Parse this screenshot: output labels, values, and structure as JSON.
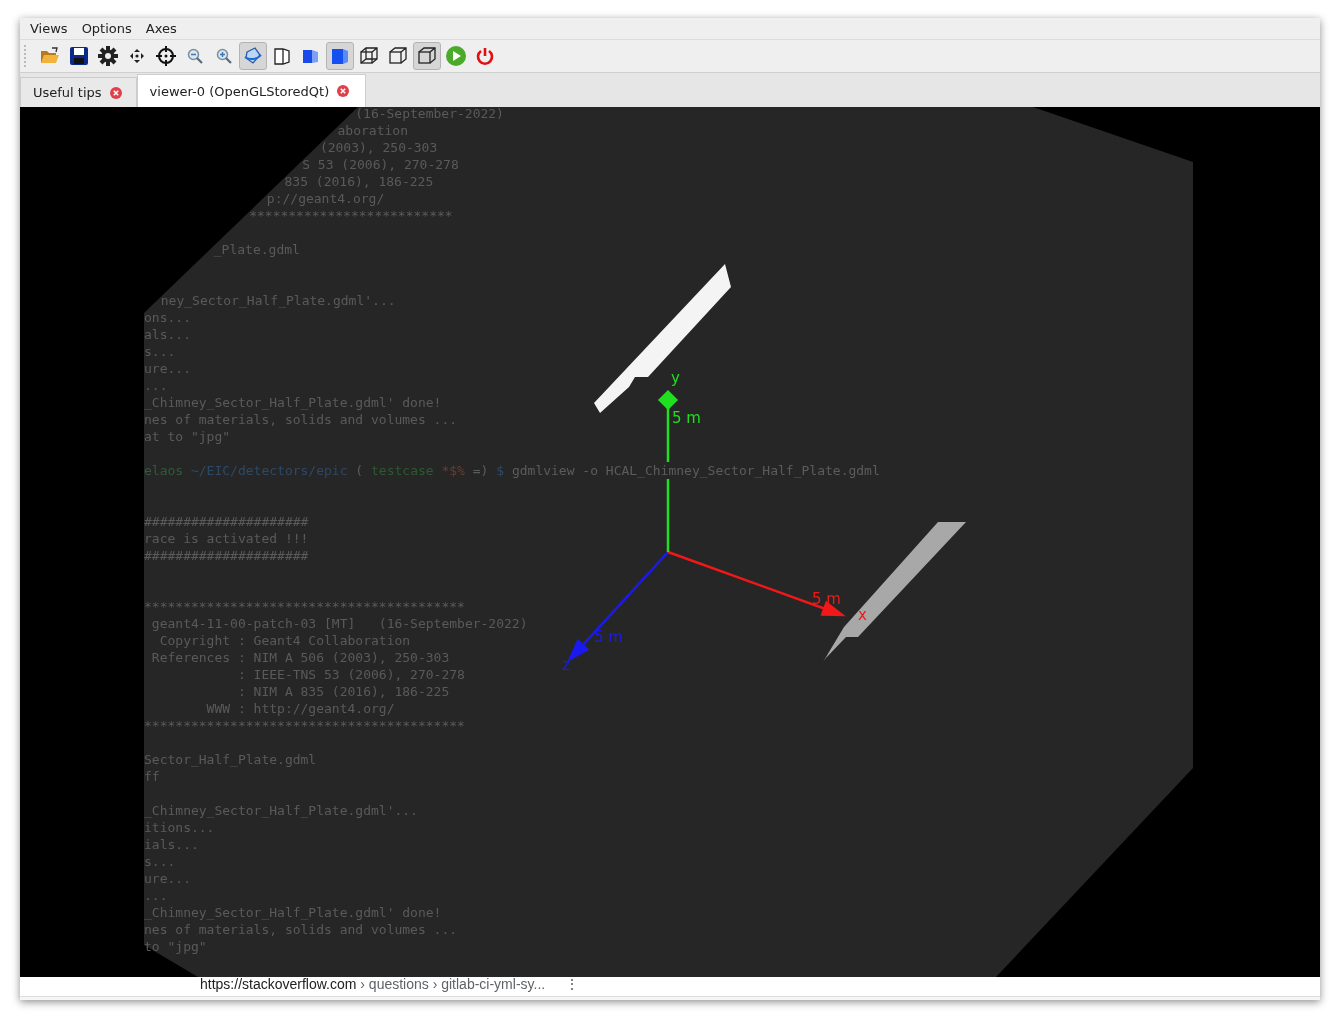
{
  "menu": [
    "Views",
    "Options",
    "Axes"
  ],
  "toolbar": [
    {
      "kind": "open",
      "pressed": false
    },
    {
      "kind": "save",
      "pressed": false
    },
    {
      "kind": "settings",
      "pressed": false
    },
    {
      "kind": "pan",
      "pressed": false
    },
    {
      "kind": "target",
      "pressed": false
    },
    {
      "kind": "zoom-out",
      "pressed": false
    },
    {
      "kind": "zoom-in",
      "pressed": false
    },
    {
      "kind": "rotate",
      "pressed": true
    },
    {
      "kind": "perspective",
      "pressed": false
    },
    {
      "kind": "half-solid",
      "pressed": false
    },
    {
      "kind": "solid",
      "pressed": true
    },
    {
      "kind": "wireframe",
      "pressed": false
    },
    {
      "kind": "hidden-line",
      "pressed": false
    },
    {
      "kind": "hidden-surface",
      "pressed": true
    },
    {
      "kind": "run",
      "pressed": false
    },
    {
      "kind": "quit",
      "pressed": false
    }
  ],
  "tabs": [
    {
      "label": "Useful tips",
      "selected": false
    },
    {
      "label": "viewer-0 (OpenGLStoredQt)",
      "selected": true
    }
  ],
  "viewer": {
    "terminal_lines": [
      {
        "kind": "text",
        "text": "(16-September-2022)"
      },
      {
        "kind": "text",
        "text": "aboration"
      },
      {
        "kind": "text",
        "text": "(2003), 250-303"
      },
      {
        "kind": "text",
        "text": "S 53 (2006), 270-278"
      },
      {
        "kind": "text",
        "text": "835 (2016), 186-225"
      },
      {
        "kind": "text",
        "text": "p://geant4.org/"
      },
      {
        "kind": "text",
        "text": "**************************"
      },
      {
        "kind": "blank"
      },
      {
        "kind": "text",
        "text": "_Plate.gdml"
      },
      {
        "kind": "blank"
      },
      {
        "kind": "blank"
      },
      {
        "kind": "text",
        "text": "ney_Sector_Half_Plate.gdml'..."
      },
      {
        "kind": "text",
        "text": "ons..."
      },
      {
        "kind": "text",
        "text": "als..."
      },
      {
        "kind": "text",
        "text": "s..."
      },
      {
        "kind": "text",
        "text": "ure..."
      },
      {
        "kind": "text",
        "text": "..."
      },
      {
        "kind": "text",
        "text": "_Chimney_Sector_Half_Plate.gdml' done!"
      },
      {
        "kind": "text",
        "text": "nes of materials, solids and volumes ..."
      },
      {
        "kind": "text",
        "text": "at to \"jpg\""
      },
      {
        "kind": "blank"
      },
      {
        "kind": "prompt",
        "segments": [
          {
            "text": "elaos",
            "color": "#2f5a3c"
          },
          {
            "text": "~/EIC/detectors/epic",
            "color": "#2c4a66"
          },
          {
            "text": "(",
            "color": "#5c5c5c"
          },
          {
            "text": "testcase",
            "color": "#2c5a30"
          },
          {
            "text": "*$%",
            "color": "#6e3a2a"
          },
          {
            "text": "=)",
            "color": "#5c5c5c"
          },
          {
            "text": "$",
            "color": "#2c4a66"
          },
          {
            "text": "gdmlview -o HCAL_Chimney_Sector_Half_Plate.gdml",
            "color": "#5c5c5c"
          }
        ]
      },
      {
        "kind": "blank"
      },
      {
        "kind": "blank"
      },
      {
        "kind": "text",
        "text": "#####################"
      },
      {
        "kind": "text",
        "text": "race is activated !!!"
      },
      {
        "kind": "text",
        "text": "#####################"
      },
      {
        "kind": "blank"
      },
      {
        "kind": "blank"
      },
      {
        "kind": "text",
        "text": "*****************************************"
      },
      {
        "kind": "text",
        "text": " geant4-11-00-patch-03 [MT]   (16-September-2022)"
      },
      {
        "kind": "text",
        "text": "  Copyright : Geant4 Collaboration"
      },
      {
        "kind": "text",
        "text": " References : NIM A 506 (2003), 250-303"
      },
      {
        "kind": "text",
        "text": "            : IEEE-TNS 53 (2006), 270-278"
      },
      {
        "kind": "text",
        "text": "            : NIM A 835 (2016), 186-225"
      },
      {
        "kind": "text",
        "text": "        WWW : http://geant4.org/"
      },
      {
        "kind": "text",
        "text": "*****************************************"
      },
      {
        "kind": "blank"
      },
      {
        "kind": "text",
        "text": "Sector_Half_Plate.gdml"
      },
      {
        "kind": "text",
        "text": "ff"
      },
      {
        "kind": "blank"
      },
      {
        "kind": "text",
        "text": "_Chimney_Sector_Half_Plate.gdml'..."
      },
      {
        "kind": "text",
        "text": "itions..."
      },
      {
        "kind": "text",
        "text": "ials..."
      },
      {
        "kind": "text",
        "text": "s..."
      },
      {
        "kind": "text",
        "text": "ure..."
      },
      {
        "kind": "text",
        "text": "..."
      },
      {
        "kind": "text",
        "text": "_Chimney_Sector_Half_Plate.gdml' done!"
      },
      {
        "kind": "text",
        "text": "nes of materials, solids and volumes ..."
      },
      {
        "kind": "text",
        "text": "to \"jpg\""
      }
    ],
    "axes": [
      {
        "name": "y",
        "scale": "5 m",
        "color": "#1ee01e"
      },
      {
        "name": "x",
        "scale": "5 m",
        "color": "#f01818"
      },
      {
        "name": "z",
        "scale": "5 m",
        "color": "#1a1af0"
      }
    ]
  },
  "status": {
    "url": "https://stackoverflow.com",
    "path": "› questions › gitlab-ci-yml-sy...",
    "menu_glyph": "⋮"
  }
}
